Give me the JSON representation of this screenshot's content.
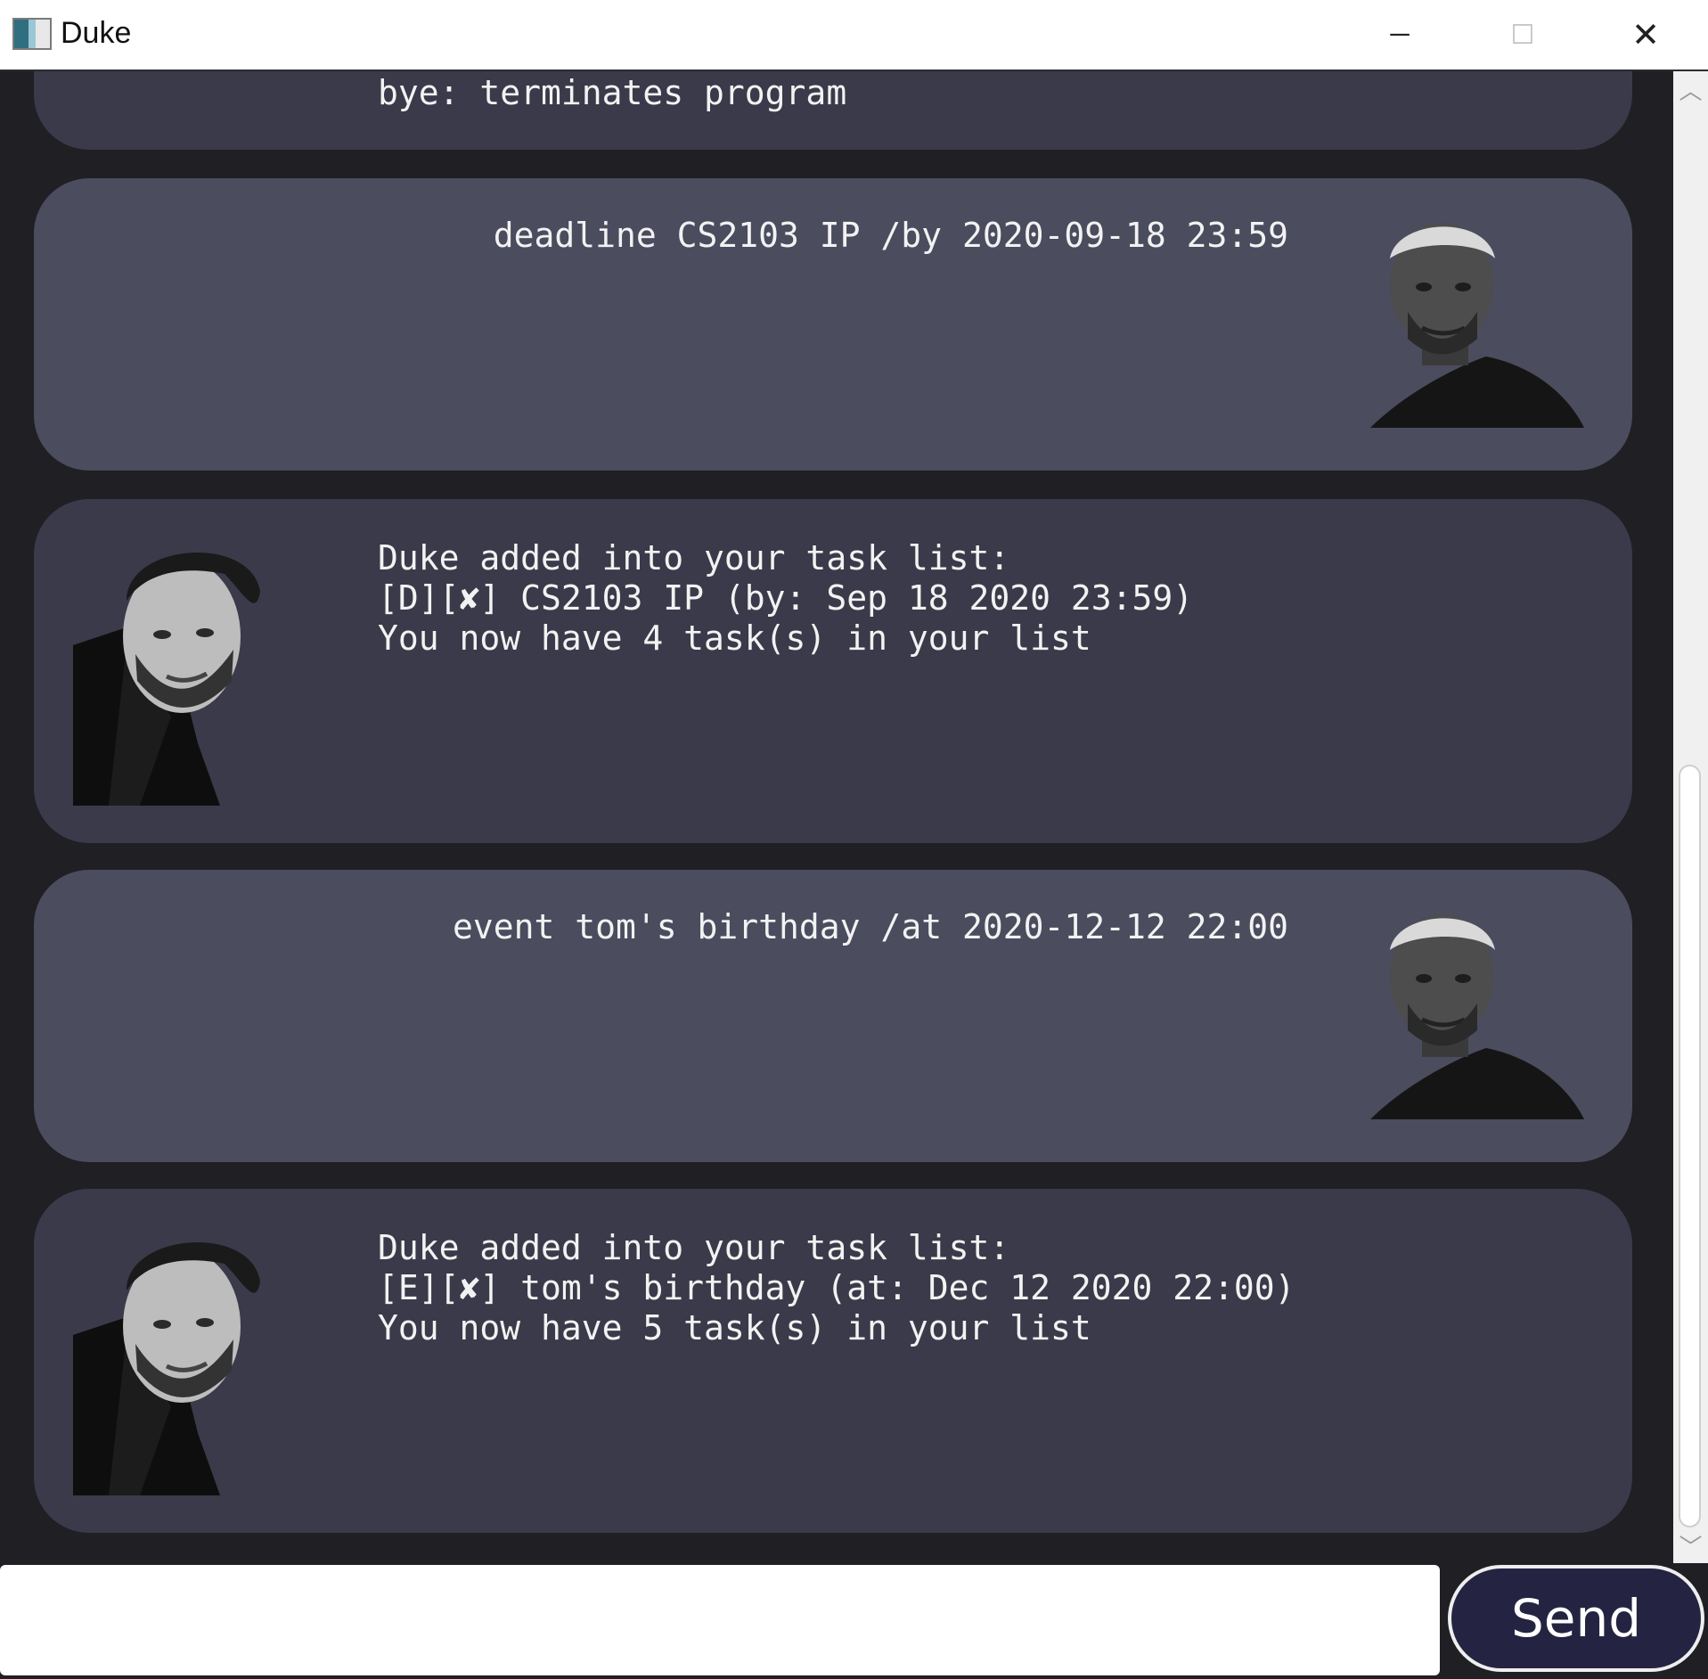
{
  "window": {
    "title": "Duke",
    "minimize_glyph": "─",
    "maximize_glyph": "☐",
    "close_glyph": "✕"
  },
  "messages": [
    {
      "sender": "duke",
      "lines": "bye: terminates program"
    },
    {
      "sender": "user",
      "lines": "deadline CS2103 IP /by 2020-09-18 23:59"
    },
    {
      "sender": "duke",
      "lines": "Duke added into your task list:\n[D][✘] CS2103 IP (by: Sep 18 2020 23:59)\nYou now have 4 task(s) in your list"
    },
    {
      "sender": "user",
      "lines": "event tom's birthday /at 2020-12-12 22:00"
    },
    {
      "sender": "duke",
      "lines": "Duke added into your task list:\n[E][✘] tom's birthday (at: Dec 12 2020 22:00)\nYou now have 5 task(s) in your list"
    }
  ],
  "input": {
    "value": "",
    "placeholder": ""
  },
  "send_label": "Send",
  "scrollbar": {
    "up_glyph": "︿",
    "down_glyph": "﹀"
  },
  "colors": {
    "background": "#1f1f24",
    "duke_bubble": "#3a3a4a",
    "user_bubble": "#4b4c5e",
    "send_button": "#242442"
  }
}
